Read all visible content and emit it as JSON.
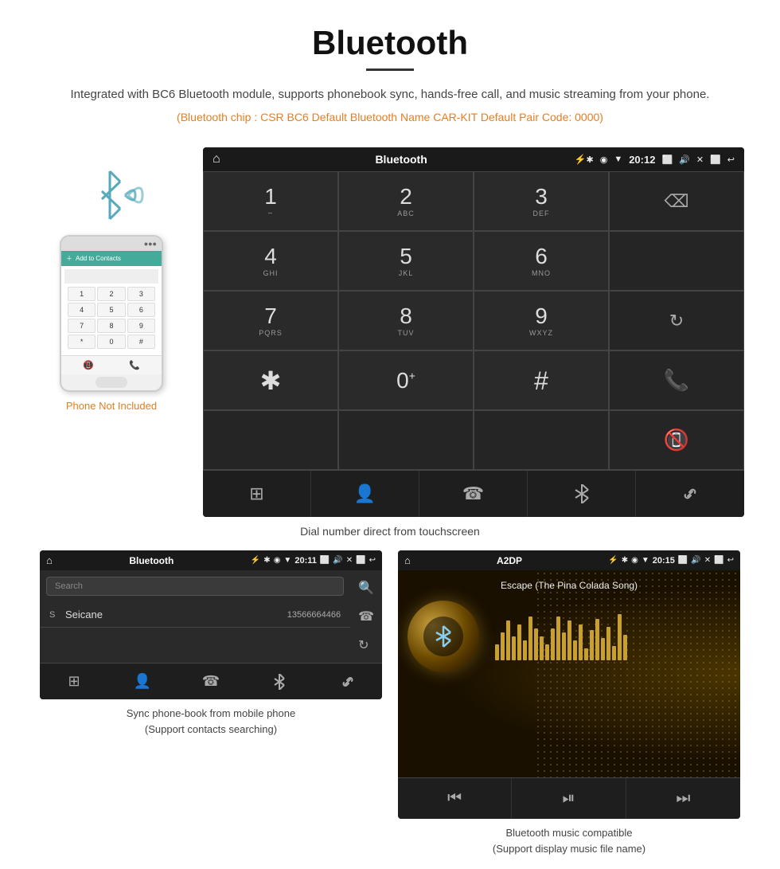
{
  "page": {
    "title": "Bluetooth",
    "underline": true,
    "description": "Integrated with BC6 Bluetooth module, supports phonebook sync, hands-free call, and music streaming from your phone.",
    "specs": "(Bluetooth chip : CSR BC6    Default Bluetooth Name CAR-KIT    Default Pair Code: 0000)",
    "phone_not_included": "Phone Not Included",
    "dial_caption": "Dial number direct from touchscreen",
    "phonebook_caption": "Sync phone-book from mobile phone\n(Support contacts searching)",
    "music_caption": "Bluetooth music compatible\n(Support display music file name)"
  },
  "status_bar": {
    "title": "Bluetooth",
    "time": "20:12"
  },
  "dialer": {
    "keys": [
      {
        "num": "1",
        "letters": ""
      },
      {
        "num": "2",
        "letters": "ABC"
      },
      {
        "num": "3",
        "letters": "DEF"
      },
      {
        "num": "4",
        "letters": "GHI"
      },
      {
        "num": "5",
        "letters": "JKL"
      },
      {
        "num": "6",
        "letters": "MNO"
      },
      {
        "num": "7",
        "letters": "PQRS"
      },
      {
        "num": "8",
        "letters": "TUV"
      },
      {
        "num": "9",
        "letters": "WXYZ"
      },
      {
        "num": "*",
        "letters": ""
      },
      {
        "num": "0",
        "letters": "+"
      },
      {
        "num": "#",
        "letters": ""
      }
    ]
  },
  "phonebook": {
    "search_placeholder": "Search",
    "entry_letter": "S",
    "entry_name": "Seicane",
    "entry_number": "13566664466",
    "status_title": "Bluetooth",
    "status_time": "20:11"
  },
  "music": {
    "status_title": "A2DP",
    "status_time": "20:15",
    "song_title": "Escape (The Pina Colada Song)"
  },
  "phone_keys": [
    "1",
    "2",
    "3",
    "4",
    "5",
    "6",
    "7",
    "8",
    "9",
    "*",
    "0",
    "#"
  ],
  "bottom_icons": [
    "grid",
    "person",
    "phone",
    "bluetooth",
    "link"
  ],
  "pb_side_icons": [
    "search",
    "phone",
    "refresh"
  ],
  "pb_bottom_icons": [
    "grid",
    "person",
    "phone",
    "bluetooth",
    "link"
  ],
  "music_controls": [
    "prev",
    "play-pause",
    "next"
  ]
}
